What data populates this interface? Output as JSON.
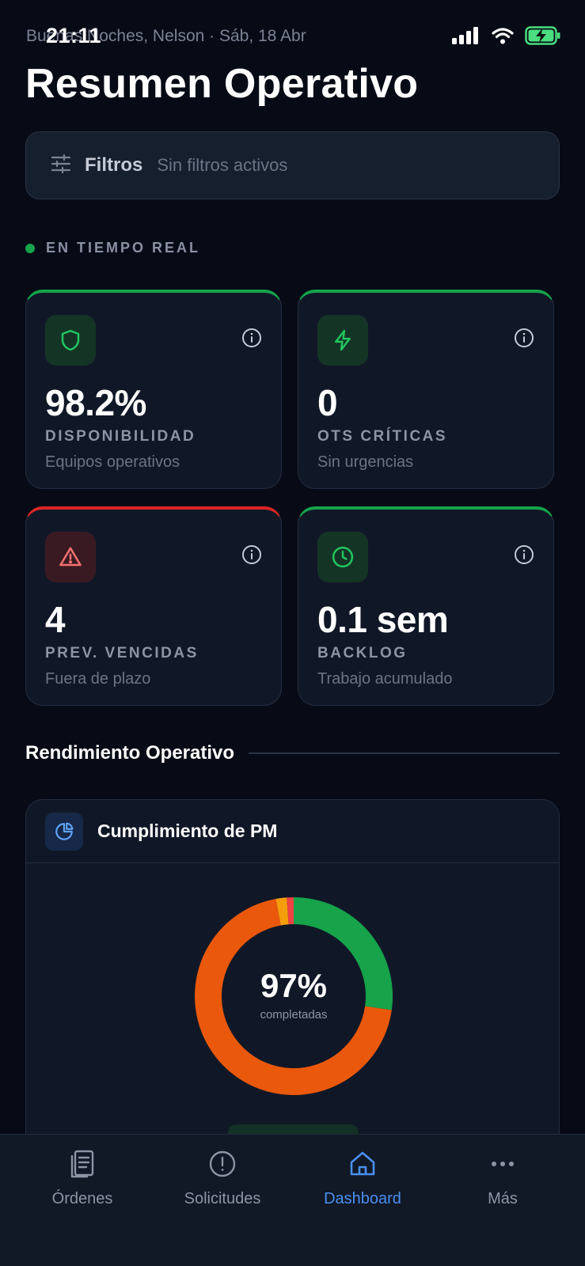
{
  "status_bar": {
    "time": "21:11"
  },
  "header": {
    "greeting": "Buenas Noches, Nelson · Sáb, 18 Abr",
    "title": "Resumen Operativo"
  },
  "filters": {
    "label": "Filtros",
    "status": "Sin filtros activos"
  },
  "live": {
    "label": "EN TIEMPO REAL",
    "color": "#16a34a"
  },
  "kpis": [
    {
      "value": "98.2%",
      "label": "DISPONIBILIDAD",
      "sub": "Equipos operativos",
      "status": "green",
      "icon": "shield-icon"
    },
    {
      "value": "0",
      "label": "OTS CRÍTICAS",
      "sub": "Sin urgencias",
      "status": "green",
      "icon": "lightning-icon"
    },
    {
      "value": "4",
      "label": "PREV. VENCIDAS",
      "sub": "Fuera de plazo",
      "status": "red",
      "icon": "warning-triangle-icon"
    },
    {
      "value": "0.1 sem",
      "label": "BACKLOG",
      "sub": "Trabajo acumulado",
      "status": "green",
      "icon": "clock-icon"
    }
  ],
  "section": {
    "title": "Rendimiento Operativo"
  },
  "pm_chart": {
    "title": "Cumplimiento de PM",
    "percent_label": "97%",
    "sub_label": "completadas",
    "segment_colors": [
      "#16a34a",
      "#ea580c",
      "#f59e0b",
      "#ef4444"
    ]
  },
  "tabs": [
    {
      "label": "Órdenes",
      "icon": "orders-icon",
      "active": false
    },
    {
      "label": "Solicitudes",
      "icon": "alert-circle-icon",
      "active": false
    },
    {
      "label": "Dashboard",
      "icon": "home-icon",
      "active": true
    },
    {
      "label": "Más",
      "icon": "more-dots-icon",
      "active": false
    }
  ],
  "colors": {
    "accent": "#4a8ff0",
    "success": "#16a34a",
    "danger": "#dc2626",
    "background": "#070b16",
    "card": "#101827"
  }
}
